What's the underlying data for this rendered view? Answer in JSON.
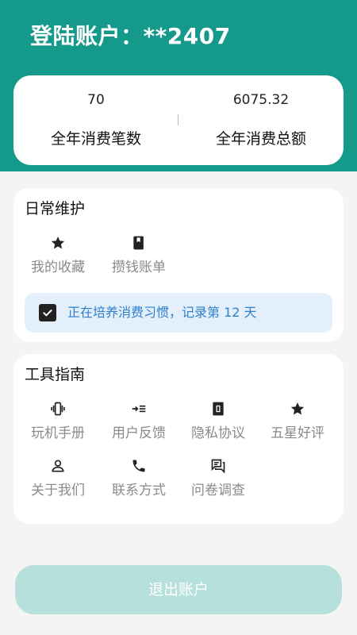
{
  "header": {
    "title": "登陆账户：**2407"
  },
  "stats": {
    "count_value": "70",
    "count_label": "全年消费笔数",
    "total_value": "6075.32",
    "total_label": "全年消费总额"
  },
  "daily": {
    "title": "日常维护",
    "items": [
      {
        "label": "我的收藏",
        "icon": "star-icon"
      },
      {
        "label": "攒钱账单",
        "icon": "book-icon"
      }
    ],
    "habit": {
      "checked": true,
      "text": "正在培养消费习惯，记录第 12 天"
    }
  },
  "tools": {
    "title": "工具指南",
    "items": [
      {
        "label": "玩机手册",
        "icon": "vibration-icon"
      },
      {
        "label": "用户反馈",
        "icon": "feedback-icon"
      },
      {
        "label": "隐私协议",
        "icon": "document-icon"
      },
      {
        "label": "五星好评",
        "icon": "star-icon"
      },
      {
        "label": "关于我们",
        "icon": "person-icon"
      },
      {
        "label": "联系方式",
        "icon": "phone-icon"
      },
      {
        "label": "问卷调查",
        "icon": "chat-icon"
      }
    ]
  },
  "logout": {
    "label": "退出账户"
  },
  "colors": {
    "brand": "#14998a",
    "habit_text": "#2f7fc9",
    "habit_bg": "#e3f0fb",
    "logout_bg": "#b6e0dc"
  }
}
